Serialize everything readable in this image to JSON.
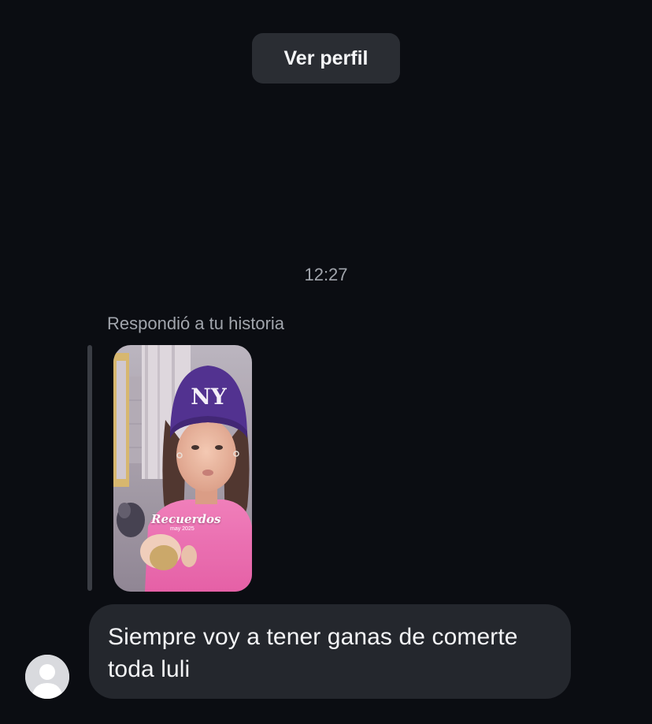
{
  "header": {
    "view_profile_label": "Ver perfil"
  },
  "conversation": {
    "timestamp": "12:27",
    "story_reply": {
      "label": "Respondió a tu historia",
      "thumbnail_caption": "Recuerdos",
      "thumbnail_date": "may 2025"
    },
    "message": {
      "line1": "Siempre voy a tener ganas de comerte",
      "line2": "toda luli"
    }
  },
  "colors": {
    "background": "#0b0d12",
    "button_bg": "#2a2d33",
    "bubble_bg": "#24272d",
    "muted_text": "#a1a5ac"
  },
  "icons": {
    "avatar": "default-user-avatar-icon"
  }
}
